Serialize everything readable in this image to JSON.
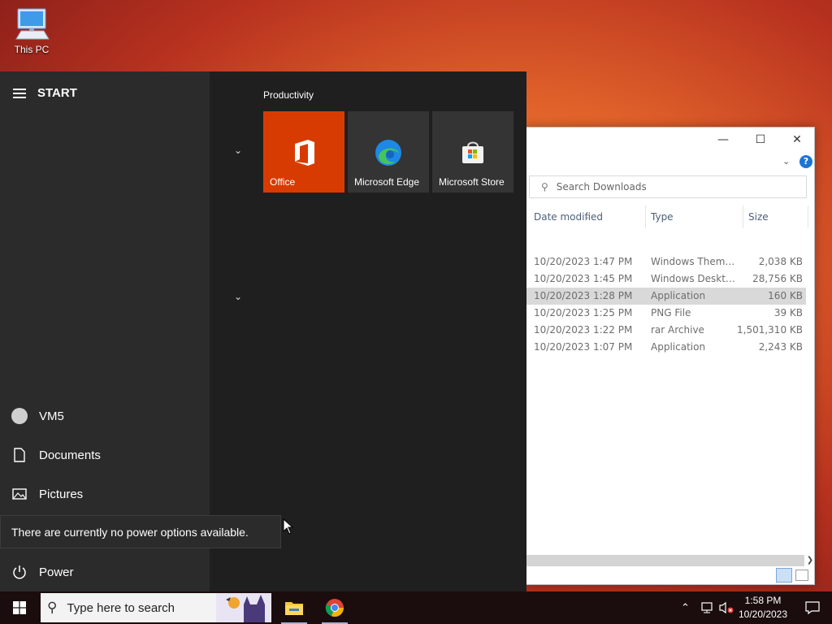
{
  "desktop": {
    "icons": [
      {
        "label": "This PC",
        "icon": "computer-icon"
      }
    ]
  },
  "explorer": {
    "search_placeholder": "Search Downloads",
    "columns": {
      "date": "Date modified",
      "type": "Type",
      "size": "Size"
    },
    "rows": [
      {
        "date": "10/20/2023 1:47 PM",
        "type": "Windows Theme ...",
        "size": "2,038 KB",
        "selected": false
      },
      {
        "date": "10/20/2023 1:45 PM",
        "type": "Windows Desktop...",
        "size": "28,756 KB",
        "selected": false
      },
      {
        "date": "10/20/2023 1:28 PM",
        "type": "Application",
        "size": "160 KB",
        "selected": true
      },
      {
        "date": "10/20/2023 1:25 PM",
        "type": "PNG File",
        "size": "39 KB",
        "selected": false
      },
      {
        "date": "10/20/2023 1:22 PM",
        "type": "rar Archive",
        "size": "1,501,310 KB",
        "selected": false
      },
      {
        "date": "10/20/2023 1:07 PM",
        "type": "Application",
        "size": "2,243 KB",
        "selected": false
      }
    ]
  },
  "start_menu": {
    "title": "START",
    "side_items": [
      {
        "label": "VM5",
        "icon": "user-avatar-icon"
      },
      {
        "label": "Documents",
        "icon": "document-icon"
      },
      {
        "label": "Pictures",
        "icon": "pictures-icon"
      },
      {
        "label": "Power",
        "icon": "power-icon"
      }
    ],
    "group_title": "Productivity",
    "tiles": [
      {
        "label": "Office",
        "icon": "office-icon",
        "color": "#d83b01"
      },
      {
        "label": "Microsoft Edge",
        "icon": "edge-icon",
        "color": "#343434"
      },
      {
        "label": "Microsoft Store",
        "icon": "store-icon",
        "color": "#343434"
      }
    ],
    "tooltip": "There are currently no power options available."
  },
  "taskbar": {
    "search_placeholder": "Type here to search",
    "apps": [
      {
        "name": "File Explorer",
        "icon": "folder-icon"
      },
      {
        "name": "Google Chrome",
        "icon": "chrome-icon"
      }
    ],
    "clock_time": "1:58 PM",
    "clock_date": "10/20/2023"
  }
}
